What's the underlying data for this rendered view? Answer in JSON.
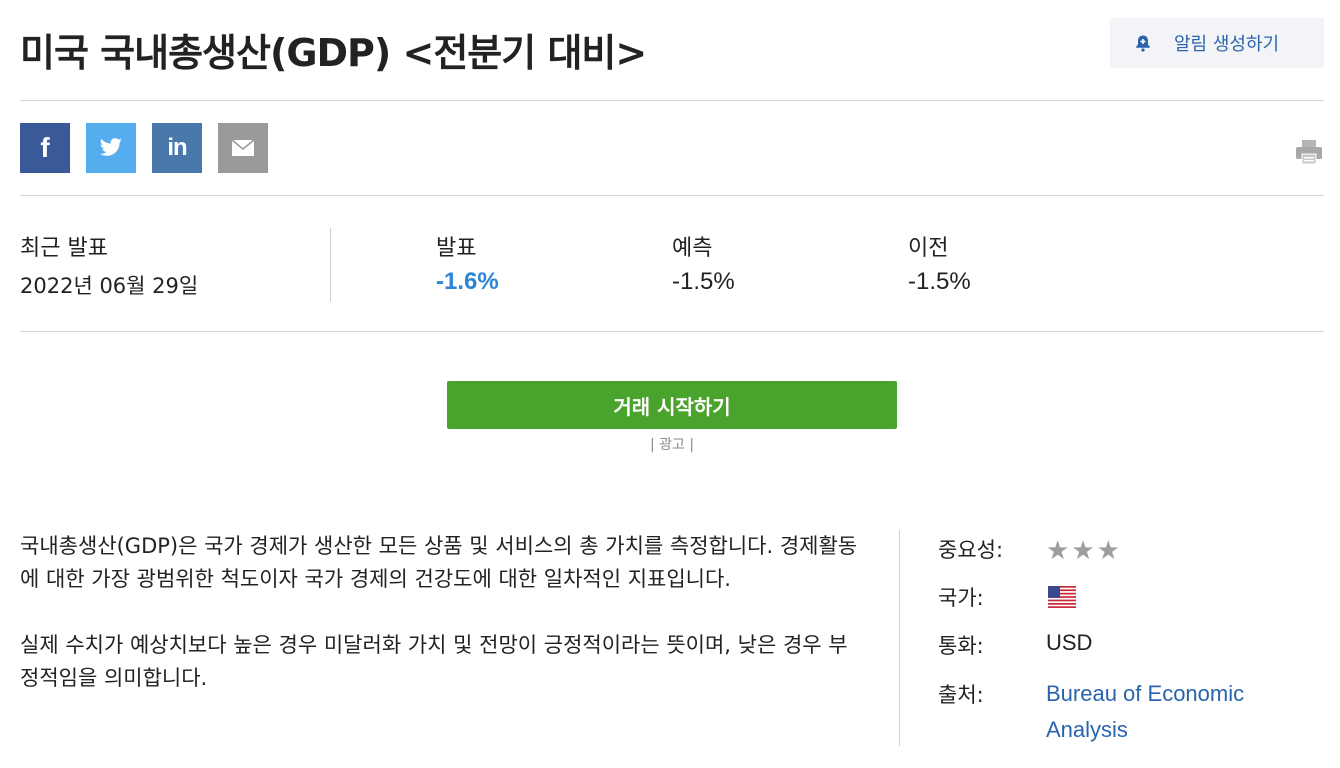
{
  "page": {
    "title": "미국 국내총생산(GDP) <전분기 대비>",
    "alert_button_label": "알림 생성하기"
  },
  "share": {
    "facebook_glyph": "f",
    "linkedin_glyph": "in",
    "icons": [
      "facebook-icon",
      "twitter-icon",
      "linkedin-icon",
      "email-icon",
      "print-icon"
    ]
  },
  "release": {
    "latest_label": "최근 발표",
    "latest_date": "2022년 06월 29일",
    "actual_label": "발표",
    "actual_value": "-1.6%",
    "forecast_label": "예측",
    "forecast_value": "-1.5%",
    "previous_label": "이전",
    "previous_value": "-1.5%"
  },
  "cta": {
    "trade_button": "거래 시작하기",
    "ad_label": "| 광고 |"
  },
  "description": {
    "paragraph_1": "국내총생산(GDP)은 국가 경제가 생산한 모든 상품 및 서비스의 총 가치를 측정합니다. 경제활동에 대한 가장 광범위한 척도이자 국가 경제의 건강도에 대한 일차적인 지표입니다.",
    "paragraph_2": "실제 수치가 예상치보다 높은 경우 미달러화 가치 및 전망이 긍정적이라는 뜻이며, 낮은 경우 부정적임을 의미합니다."
  },
  "info": {
    "importance_label": "중요성:",
    "importance_rating": 3,
    "importance_max": 3,
    "country_label": "국가:",
    "country_flag": "us-flag-icon",
    "currency_label": "통화:",
    "currency_value": "USD",
    "source_label": "출처:",
    "source_value": "Bureau of Economic Analysis"
  },
  "colors": {
    "actual_value": "#2c85d6",
    "trade_button": "#4aa32c",
    "link": "#2a64ad",
    "facebook": "#3b5998",
    "twitter": "#55acee",
    "linkedin": "#4a78aa",
    "email": "#9a9a9a"
  }
}
